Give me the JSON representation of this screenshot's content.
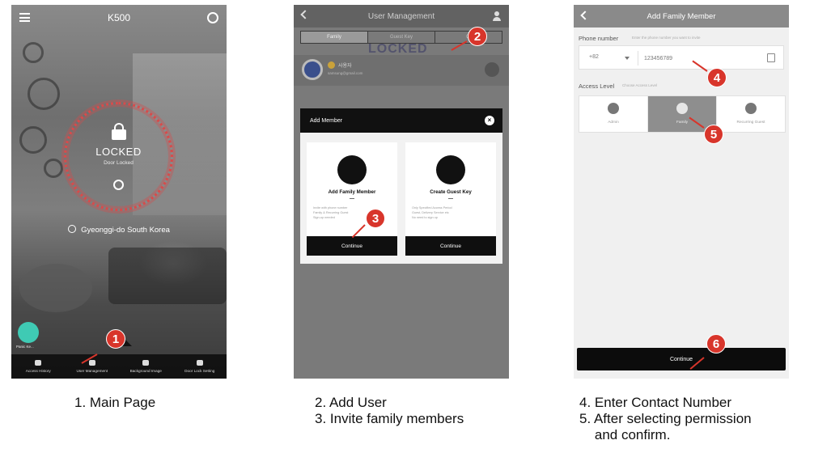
{
  "screen1": {
    "title": "K500",
    "lock_state": "LOCKED",
    "lock_sub": "Door Locked",
    "location": "Gyeonggi-do South Korea",
    "panic_label": "Panic Ke...",
    "nav": [
      "Access History",
      "User Management",
      "Background Image",
      "Door Lock Setting"
    ]
  },
  "screen2": {
    "title": "User Management",
    "tabs": [
      "Family",
      "Guest Key",
      "Ot"
    ],
    "bg_text": "LOCKED",
    "member_name": "사용자",
    "member_email": "samsung@gmail.com",
    "modal": {
      "title": "Add Member",
      "cards": [
        {
          "title": "Add Family Member",
          "dash": "—",
          "lines": [
            "Invite with phone number",
            "Family & Recurring Guest",
            "Sign-up needed"
          ],
          "button": "Continue"
        },
        {
          "title": "Create Guest Key",
          "dash": "—",
          "lines": [
            "Only Specified Access Period",
            "Guest, Delivery Service etc",
            "No need to sign up"
          ],
          "button": "Continue"
        }
      ]
    }
  },
  "screen3": {
    "title": "Add Family Member",
    "phone_label": "Phone number",
    "phone_hint": "Enter the phone number you want to invite",
    "country_code": "+82",
    "phone_value": "123456789",
    "access_label": "Access Level",
    "access_hint": "Choose Access Level",
    "levels": [
      "Admin",
      "Family",
      "Recurring Guest"
    ],
    "continue": "Continue"
  },
  "markers": [
    "1",
    "2",
    "3",
    "4",
    "5",
    "6"
  ],
  "captions": {
    "c1": "1. Main Page",
    "c2": "2. Add User\n3. Invite family members",
    "c3": "4. Enter Contact Number\n5. After selecting permission\n    and confirm."
  },
  "colors": {
    "marker": "#d8352b",
    "lock_ring": "#d84b4b",
    "panic": "#3fcab4"
  }
}
